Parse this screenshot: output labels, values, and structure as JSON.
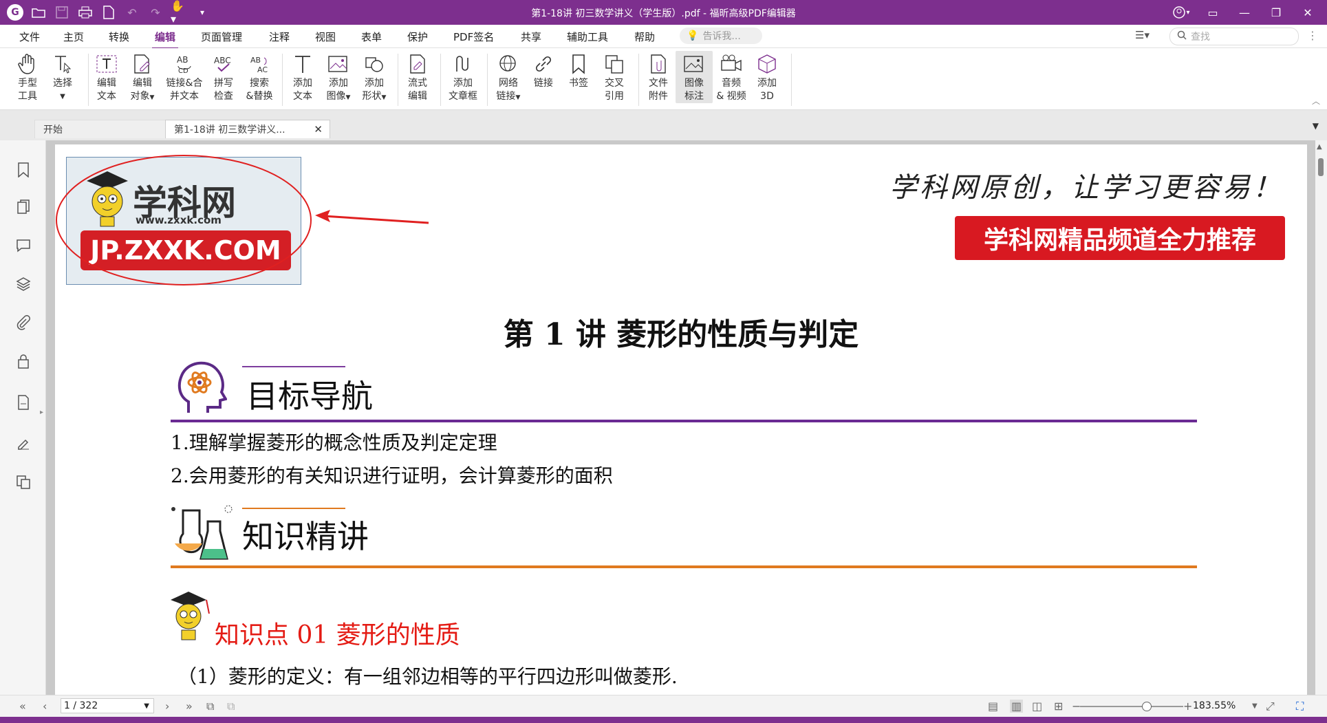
{
  "titlebar": {
    "title": "第1-18讲  初三数学讲义（学生版）.pdf - 福昕高级PDF编辑器",
    "logo": "G"
  },
  "menu": {
    "items": [
      "文件",
      "主页",
      "转换",
      "编辑",
      "页面管理",
      "注释",
      "视图",
      "表单",
      "保护",
      "PDF签名",
      "共享",
      "辅助工具",
      "帮助"
    ],
    "active": "编辑",
    "tell_me": "告诉我...",
    "search_placeholder": "查找"
  },
  "ribbon": {
    "tools": [
      {
        "l1": "手型",
        "l2": "工具",
        "icon": "hand-icon"
      },
      {
        "l1": "选择",
        "l2": "",
        "icon": "select-text-icon"
      },
      {
        "l1": "编辑",
        "l2": "文本",
        "icon": "edit-text-icon"
      },
      {
        "l1": "编辑",
        "l2": "对象",
        "icon": "edit-object-icon"
      },
      {
        "l1": "链接&合",
        "l2": "并文本",
        "icon": "link-merge-icon"
      },
      {
        "l1": "拼写",
        "l2": "检查",
        "icon": "spell-check-icon"
      },
      {
        "l1": "搜索",
        "l2": "&替换",
        "icon": "search-replace-icon"
      },
      {
        "l1": "添加",
        "l2": "文本",
        "icon": "add-text-icon"
      },
      {
        "l1": "添加",
        "l2": "图像",
        "icon": "add-image-icon"
      },
      {
        "l1": "添加",
        "l2": "形状",
        "icon": "add-shape-icon"
      },
      {
        "l1": "流式",
        "l2": "编辑",
        "icon": "reflow-edit-icon"
      },
      {
        "l1": "添加",
        "l2": "文章框",
        "icon": "article-box-icon"
      },
      {
        "l1": "网络",
        "l2": "链接",
        "icon": "web-link-icon"
      },
      {
        "l1": "链接",
        "l2": "",
        "icon": "link-icon"
      },
      {
        "l1": "书签",
        "l2": "",
        "icon": "bookmark-icon"
      },
      {
        "l1": "交叉",
        "l2": "引用",
        "icon": "cross-reference-icon"
      },
      {
        "l1": "文件",
        "l2": "附件",
        "icon": "file-attachment-icon"
      },
      {
        "l1": "图像",
        "l2": "标注",
        "icon": "image-annotation-icon"
      },
      {
        "l1": "音频",
        "l2": "& 视频",
        "icon": "audio-video-icon"
      },
      {
        "l1": "添加",
        "l2": "3D",
        "icon": "add-3d-icon"
      }
    ]
  },
  "tabs": {
    "start": "开始",
    "doc": "第1-18讲  初三数学讲义...",
    "close": "✕"
  },
  "pdf": {
    "logo_main": "学科网",
    "logo_sub": "www.zxxk.com",
    "logo_red": "JP.ZXXK.COM",
    "slogan": "学科网原创，让学习更容易！",
    "banner": "学科网精品频道全力推荐",
    "title": "第 1 讲    菱形的性质与判定",
    "sec1": "目标导航",
    "goal1": "1.理解掌握菱形的概念性质及判定定理",
    "goal2": "2.会用菱形的有关知识进行证明，会计算菱形的面积",
    "sec2": "知识精讲",
    "kp": "知识点 01   菱形的性质",
    "def": "（1）菱形的定义：有一组邻边相等的平行四边形叫做菱形."
  },
  "status": {
    "page": "1 / 322",
    "zoom": "183.55%"
  },
  "colors": {
    "brand": "#7d2f8e",
    "accent_red": "#e41b14",
    "section1_line": "#6a2a93",
    "section2_line": "#e07a1f"
  }
}
